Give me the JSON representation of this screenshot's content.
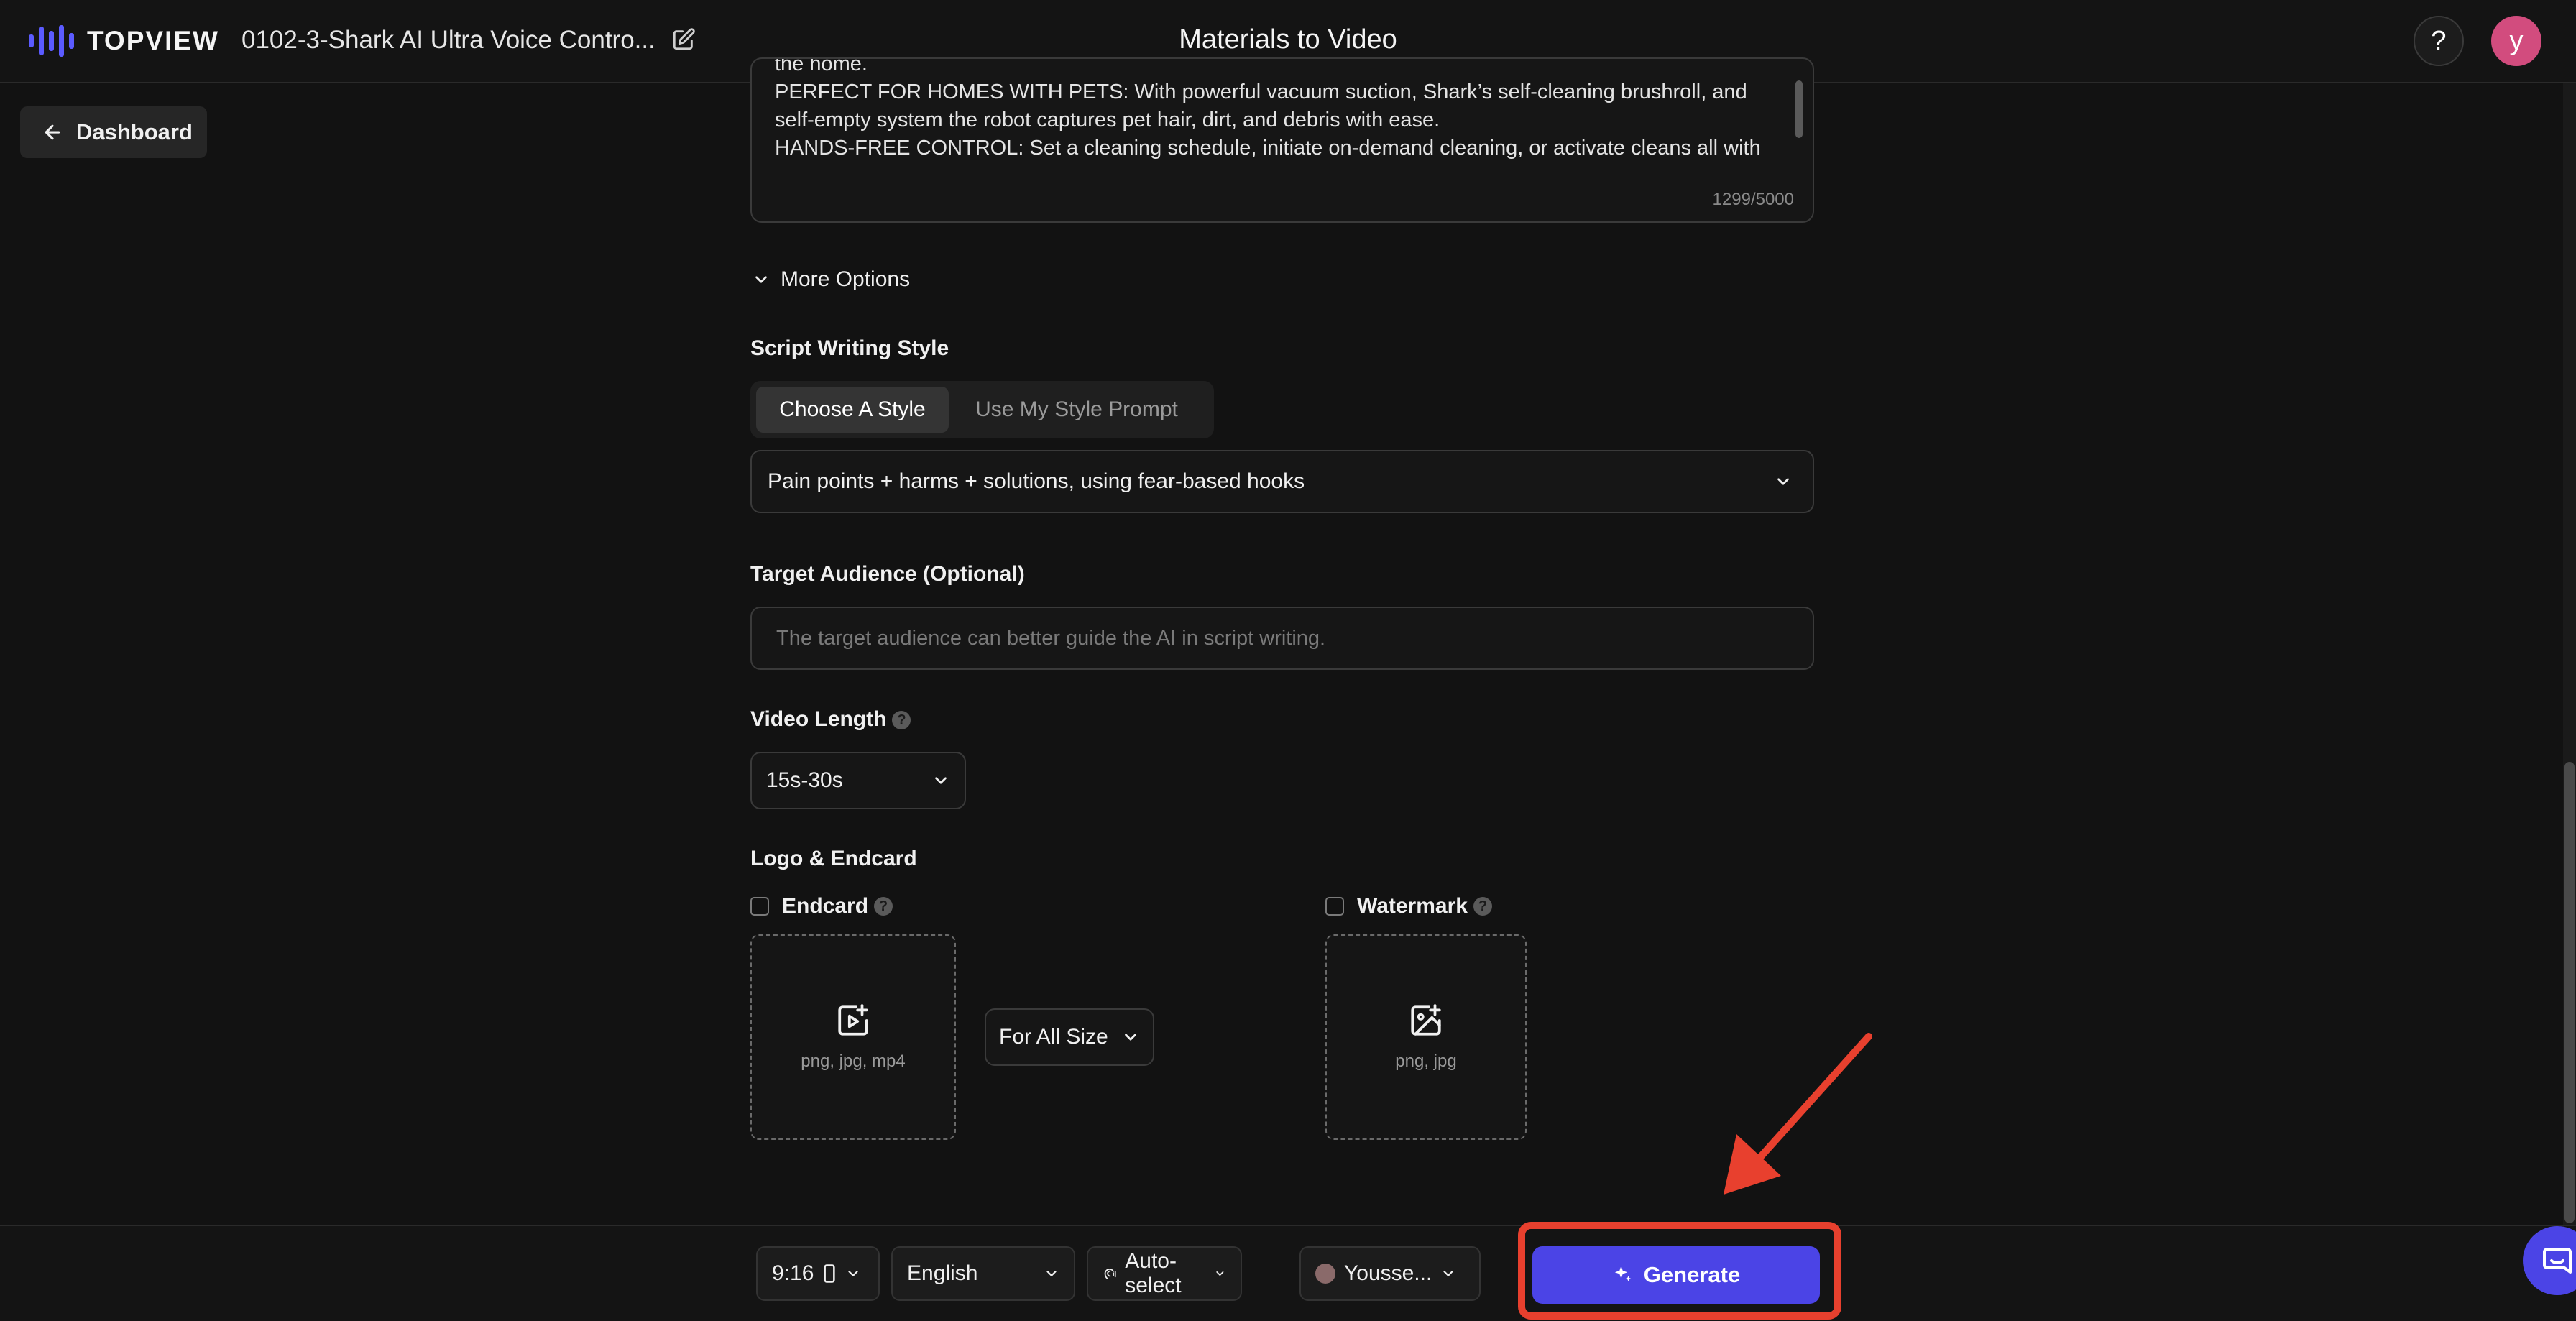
{
  "header": {
    "logo_text": "TOPVIEW",
    "project_title": "0102-3-Shark AI Ultra Voice Contro...",
    "page_title": "Materials to Video",
    "help_label": "?",
    "avatar_letter": "y"
  },
  "nav": {
    "dashboard_label": "Dashboard"
  },
  "description": {
    "lines": [
      "the home.",
      "PERFECT FOR HOMES WITH PETS: With powerful vacuum suction, Shark’s self-cleaning brushroll, and",
      "self-empty system the robot captures pet hair, dirt, and debris with ease.",
      "HANDS-FREE CONTROL: Set a cleaning schedule, initiate on-demand cleaning, or activate cleans all with"
    ],
    "char_count": "1299/5000"
  },
  "more_options_label": "More Options",
  "script_style": {
    "label": "Script Writing Style",
    "tabs": [
      "Choose A Style",
      "Use My Style Prompt"
    ],
    "selected_style": "Pain points + harms + solutions, using fear-based hooks"
  },
  "target_audience": {
    "label": "Target Audience (Optional)",
    "placeholder": "The target audience can better guide the AI in script writing.",
    "value": ""
  },
  "video_length": {
    "label": "Video Length",
    "help": "?",
    "value": "15s-30s"
  },
  "logo_endcard": {
    "label": "Logo & Endcard",
    "endcard": {
      "label": "Endcard",
      "help": "?",
      "checked": false,
      "formats": "png, jpg, mp4"
    },
    "size_option": "For All Size",
    "watermark": {
      "label": "Watermark",
      "help": "?",
      "checked": false,
      "formats": "png, jpg"
    }
  },
  "bottom_bar": {
    "aspect_ratio": "9:16",
    "language": "English",
    "voice": "Auto-select",
    "avatar_name": "Yousse...",
    "generate_label": "Generate"
  },
  "colors": {
    "accent": "#4b44e6",
    "logo_accent": "#5b5bff",
    "avatar_bg": "#d24c7e",
    "annotation": "#e8402e",
    "background": "#121212"
  },
  "icons": [
    "edit-icon",
    "arrow-left-icon",
    "chevron-down-icon",
    "video-plus-icon",
    "image-plus-icon",
    "phone-icon",
    "voice-icon",
    "sparkle-icon",
    "chat-icon"
  ]
}
